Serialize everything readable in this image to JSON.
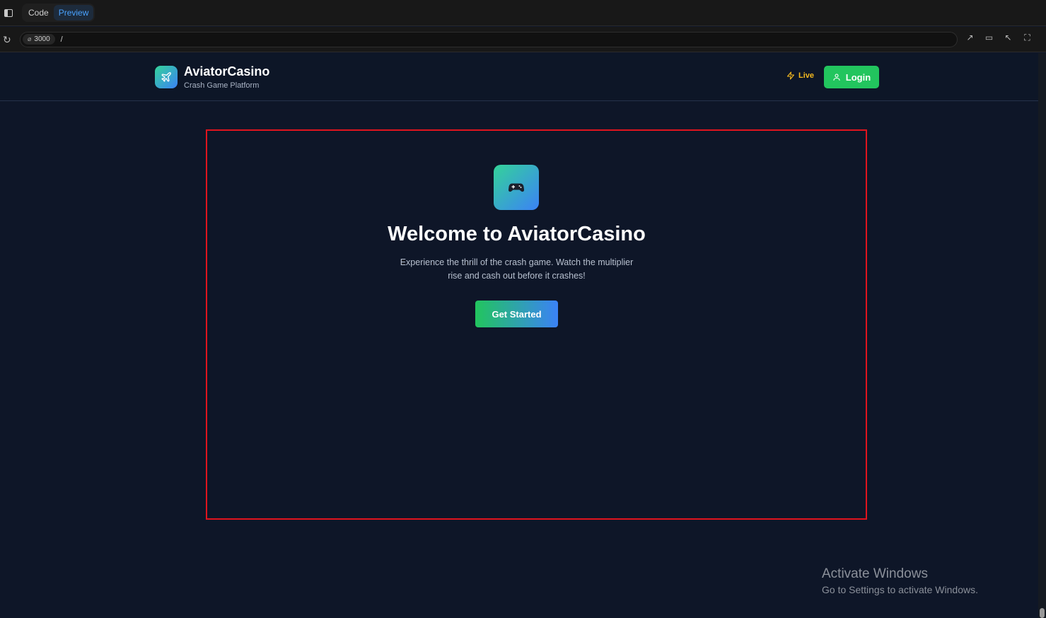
{
  "ide": {
    "tabs": [
      {
        "label": "Code",
        "active": false
      },
      {
        "label": "Preview",
        "active": true
      }
    ]
  },
  "address": {
    "port": "3000",
    "path": "/"
  },
  "header": {
    "brand_name": "AviatorCasino",
    "brand_tagline": "Crash Game Platform",
    "live_label": "Live",
    "login_label": "Login"
  },
  "hero": {
    "title": "Welcome to AviatorCasino",
    "description": "Experience the thrill of the crash game. Watch the multiplier rise and cash out before it crashes!",
    "cta_label": "Get Started"
  },
  "watermark": {
    "line1": "Activate Windows",
    "line2": "Go to Settings to activate Windows."
  },
  "colors": {
    "background": "#0e1628",
    "accent_green": "#22c55e",
    "accent_blue": "#3b82f6",
    "live_yellow": "#f5b91f",
    "highlight_red": "#e0141e"
  },
  "icons": {
    "brand": "plane-icon",
    "hero": "gamepad-icon",
    "live": "lightning-icon",
    "login": "user-icon"
  }
}
